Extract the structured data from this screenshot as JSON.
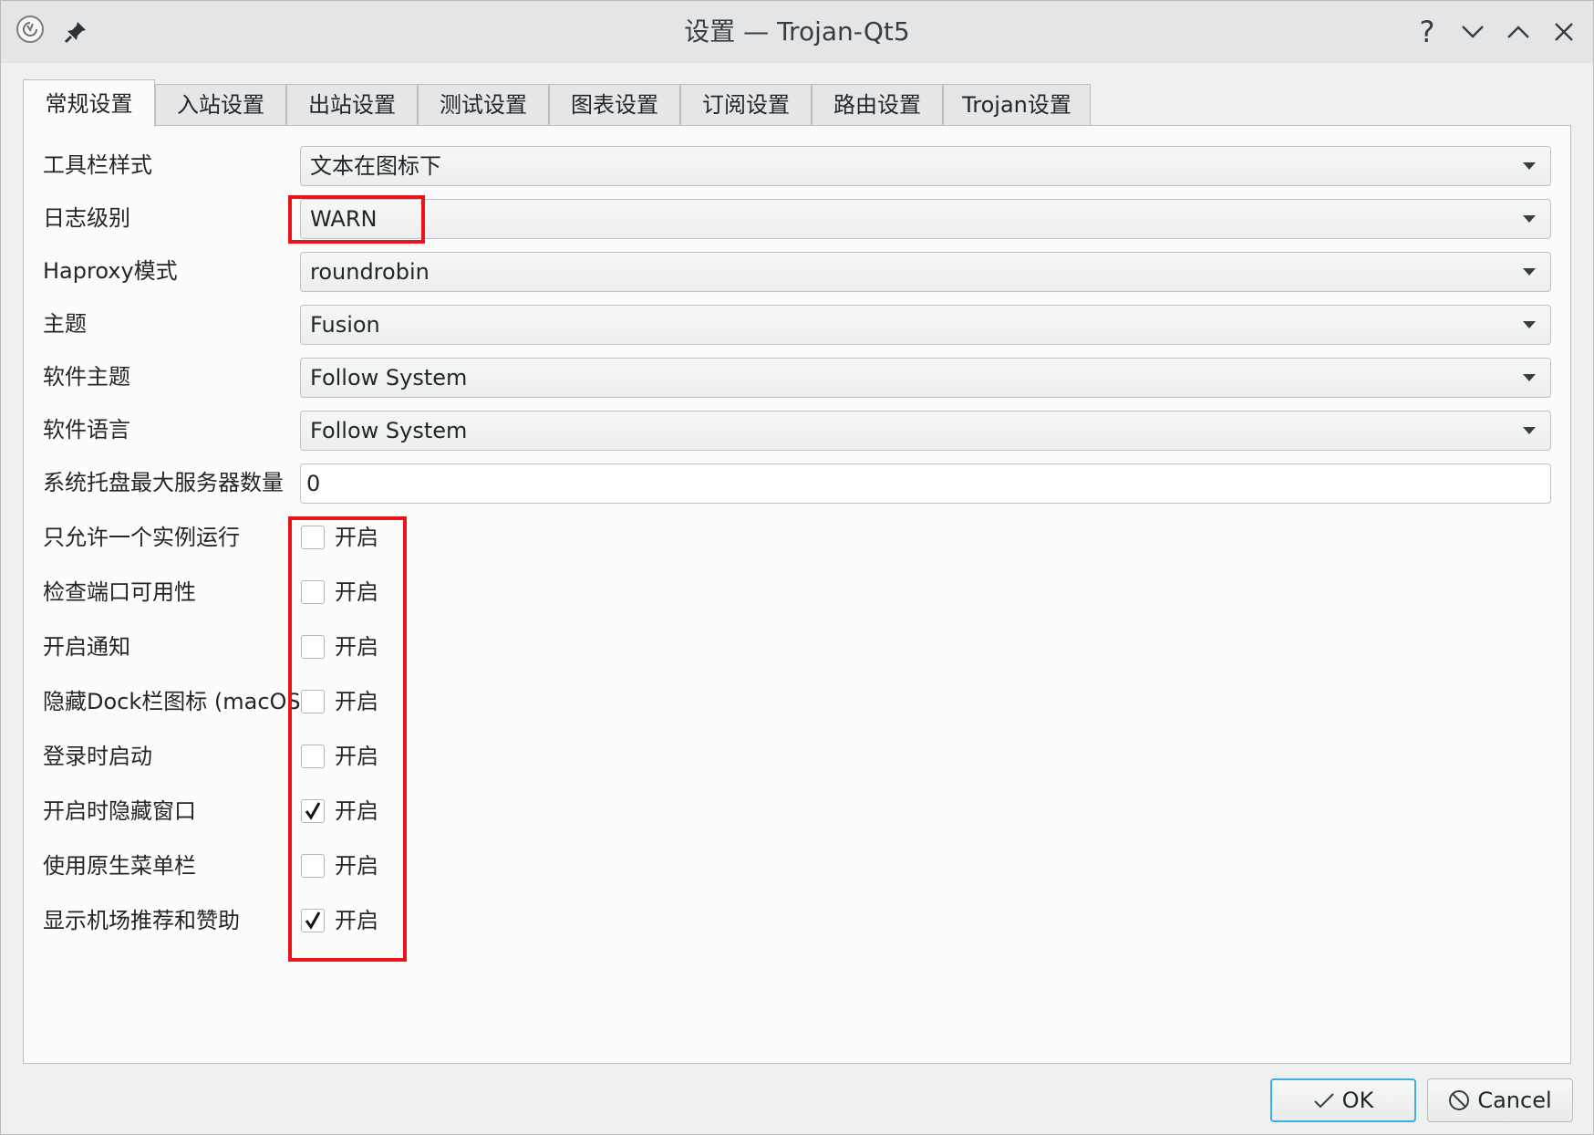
{
  "window": {
    "title": "设置 — Trojan-Qt5",
    "help_glyph": "?",
    "minimize_glyph": "∨",
    "maximize_glyph": "∧",
    "close_glyph": "✕"
  },
  "tabs": [
    {
      "label": "常规设置",
      "active": true
    },
    {
      "label": "入站设置"
    },
    {
      "label": "出站设置"
    },
    {
      "label": "测试设置"
    },
    {
      "label": "图表设置"
    },
    {
      "label": "订阅设置"
    },
    {
      "label": "路由设置"
    },
    {
      "label": "Trojan设置"
    }
  ],
  "general": {
    "toolbar_style": {
      "label": "工具栏样式",
      "value": "文本在图标下"
    },
    "log_level": {
      "label": "日志级别",
      "value": "WARN"
    },
    "haproxy_mode": {
      "label": "Haproxy模式",
      "value": "roundrobin"
    },
    "theme": {
      "label": "主题",
      "value": "Fusion"
    },
    "software_theme": {
      "label": "软件主题",
      "value": "Follow System"
    },
    "software_language": {
      "label": "软件语言",
      "value": "Follow System"
    },
    "tray_max_servers": {
      "label": "系统托盘最大服务器数量",
      "value": "0"
    }
  },
  "options": [
    {
      "label": "只允许一个实例运行",
      "checkbox_text": "开启",
      "checked": false
    },
    {
      "label": "检查端口可用性",
      "checkbox_text": "开启",
      "checked": false
    },
    {
      "label": "开启通知",
      "checkbox_text": "开启",
      "checked": false
    },
    {
      "label": "隐藏Dock栏图标 (macOS)",
      "checkbox_text": "开启",
      "checked": false
    },
    {
      "label": "登录时启动",
      "checkbox_text": "开启",
      "checked": false
    },
    {
      "label": "开启时隐藏窗口",
      "checkbox_text": "开启",
      "checked": true
    },
    {
      "label": "使用原生菜单栏",
      "checkbox_text": "开启",
      "checked": false
    },
    {
      "label": "显示机场推荐和赞助",
      "checkbox_text": "开启",
      "checked": true
    }
  ],
  "buttons": {
    "ok": "OK",
    "cancel": "Cancel"
  },
  "colors": {
    "highlight_box": "#e8141a",
    "focus_accent": "#3daee9"
  }
}
